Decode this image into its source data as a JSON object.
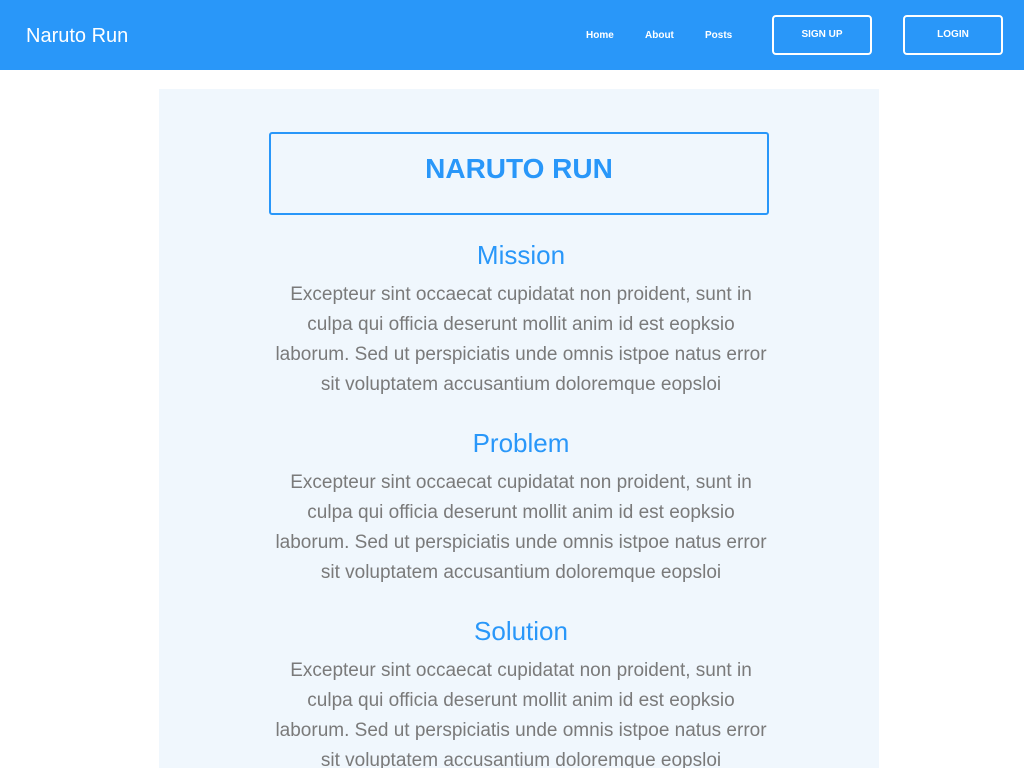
{
  "navbar": {
    "brand": "Naruto Run",
    "links": [
      "Home",
      "About",
      "Posts"
    ],
    "signup_label": "SIGN UP",
    "login_label": "LOGIN"
  },
  "main": {
    "title": "NARUTO RUN",
    "sections": [
      {
        "heading": "Mission",
        "body": "Excepteur sint occaecat cupidatat non proident, sunt in culpa qui officia deserunt mollit anim id est eopksio laborum. Sed ut perspiciatis unde omnis istpoe natus error sit voluptatem accusantium doloremque eopsloi"
      },
      {
        "heading": "Problem",
        "body": "Excepteur sint occaecat cupidatat non proident, sunt in culpa qui officia deserunt mollit anim id est eopksio laborum. Sed ut perspiciatis unde omnis istpoe natus error sit voluptatem accusantium doloremque eopsloi"
      },
      {
        "heading": "Solution",
        "body": "Excepteur sint occaecat cupidatat non proident, sunt in culpa qui officia deserunt mollit anim id est eopksio laborum. Sed ut perspiciatis unde omnis istpoe natus error sit voluptatem accusantium doloremque eopsloi"
      }
    ]
  },
  "colors": {
    "primary": "#2997f9",
    "content_bg": "#f0f7fd",
    "body_text": "#7a7a7a"
  }
}
